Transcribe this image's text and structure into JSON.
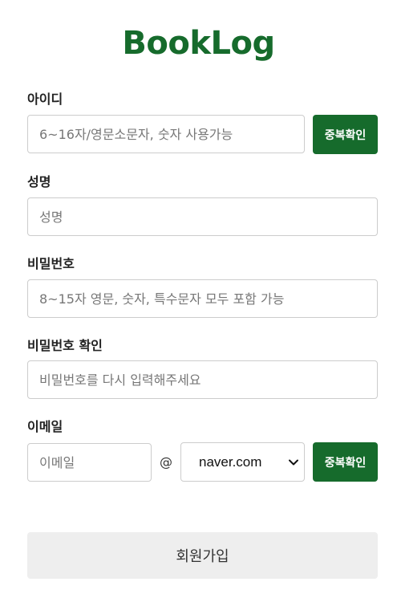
{
  "app": {
    "logo": "BookLog"
  },
  "form": {
    "userid": {
      "label": "아이디",
      "placeholder": "6~16자/영문소문자, 숫자 사용가능",
      "value": "",
      "check_button": "중복확인"
    },
    "name": {
      "label": "성명",
      "placeholder": "성명",
      "value": ""
    },
    "password": {
      "label": "비밀번호",
      "placeholder": "8~15자 영문, 숫자, 특수문자 모두 포함 가능",
      "value": ""
    },
    "password_confirm": {
      "label": "비밀번호 확인",
      "placeholder": "비밀번호를 다시 입력해주세요",
      "value": ""
    },
    "email": {
      "label": "이메일",
      "placeholder": "이메일",
      "value": "",
      "at_symbol": "@",
      "domain_selected": "naver.com",
      "check_button": "중복확인"
    },
    "submit_label": "회원가입"
  },
  "colors": {
    "brand_green": "#166b2c",
    "submit_bg": "#eeeeee",
    "border": "#cccccc"
  },
  "icons": {
    "domain_dropdown": "chevron-down-icon"
  }
}
